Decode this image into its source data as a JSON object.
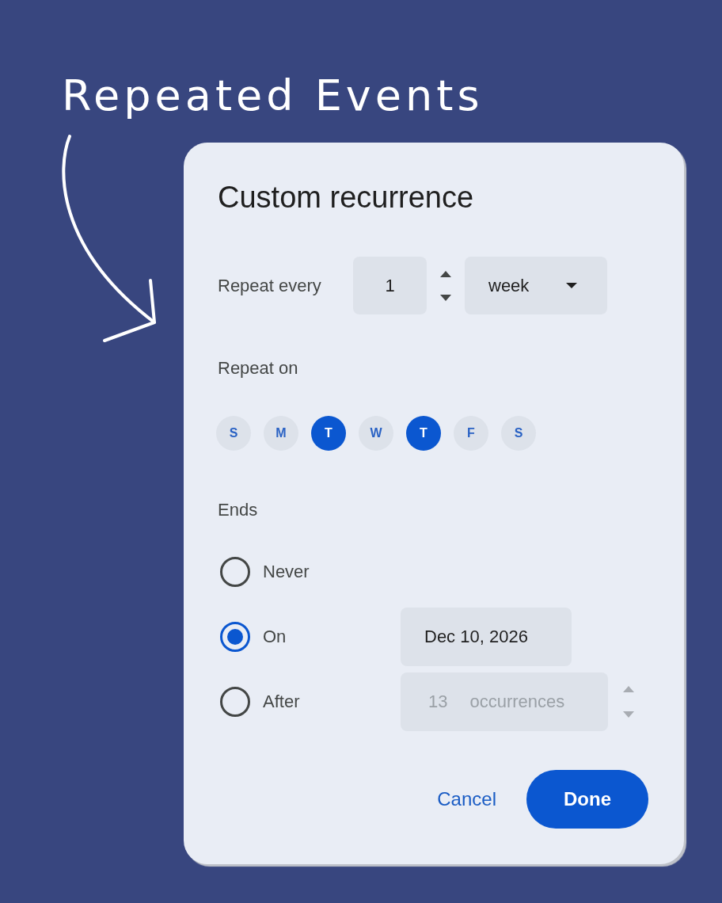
{
  "annotation": {
    "title": "Repeated Events"
  },
  "dialog": {
    "title": "Custom recurrence",
    "repeat_every": {
      "label": "Repeat every",
      "value": "1",
      "unit": "week"
    },
    "repeat_on": {
      "label": "Repeat on",
      "days": [
        {
          "label": "S",
          "selected": false
        },
        {
          "label": "M",
          "selected": false
        },
        {
          "label": "T",
          "selected": true
        },
        {
          "label": "W",
          "selected": false
        },
        {
          "label": "T",
          "selected": true
        },
        {
          "label": "F",
          "selected": false
        },
        {
          "label": "S",
          "selected": false
        }
      ]
    },
    "ends": {
      "label": "Ends",
      "options": [
        {
          "label": "Never",
          "selected": false
        },
        {
          "label": "On",
          "selected": true,
          "field": {
            "kind": "date",
            "value": "Dec 10, 2026",
            "disabled": false
          }
        },
        {
          "label": "After",
          "selected": false,
          "field": {
            "kind": "count",
            "value": "13",
            "suffix": "occurrences",
            "disabled": true
          }
        }
      ]
    },
    "buttons": [
      {
        "label": "Cancel",
        "kind": "text"
      },
      {
        "label": "Done",
        "kind": "filled"
      }
    ]
  }
}
